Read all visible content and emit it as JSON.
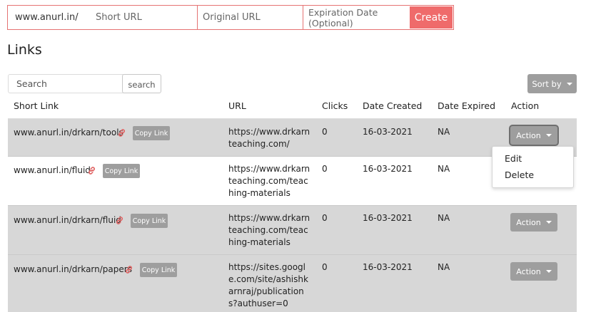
{
  "create_form": {
    "domain_prefix": "www.anurl.in/",
    "short_url_placeholder": "Short URL",
    "original_url_placeholder": "Original URL",
    "expiration_placeholder": "Expiration Date (Optional)",
    "create_label": "Create",
    "border_color": "#e57373",
    "create_color": "#ef6b6b"
  },
  "heading": "Links",
  "search": {
    "placeholder": "Search",
    "button_label": "search"
  },
  "sort_label": "Sort by",
  "columns": [
    "Short Link",
    "URL",
    "Clicks",
    "Date Created",
    "Date Expired",
    "Action"
  ],
  "rows": [
    {
      "short_link": "www.anurl.in/drkarn/tools",
      "copy_label": "Copy Link",
      "url": "https://www.drkarnteaching.com/",
      "clicks": "0",
      "date_created": "16-03-2021",
      "date_expired": "NA",
      "action_label": "Action"
    },
    {
      "short_link": "www.anurl.in/fluid",
      "copy_label": "Copy Link",
      "url": "https://www.drkarnteaching.com/teaching-materials",
      "clicks": "0",
      "date_created": "16-03-2021",
      "date_expired": "NA",
      "action_label": "Action"
    },
    {
      "short_link": "www.anurl.in/drkarn/fluid",
      "copy_label": "Copy Link",
      "url": "https://www.drkarnteaching.com/teaching-materials",
      "clicks": "0",
      "date_created": "16-03-2021",
      "date_expired": "NA",
      "action_label": "Action"
    },
    {
      "short_link": "www.anurl.in/drkarn/papers",
      "copy_label": "Copy Link",
      "url": "https://sites.google.com/site/ashishkarnraj/publications?authuser=0",
      "clicks": "0",
      "date_created": "16-03-2021",
      "date_expired": "NA",
      "action_label": "Action"
    }
  ],
  "action_menu": {
    "items": [
      "Edit",
      "Delete"
    ]
  },
  "icons": {
    "link": "link-icon",
    "caret": "caret-down-icon"
  },
  "colors": {
    "row_shade": "#d7d7d7",
    "button_gray": "#9e9e9e",
    "link_icon": "#e06666"
  }
}
